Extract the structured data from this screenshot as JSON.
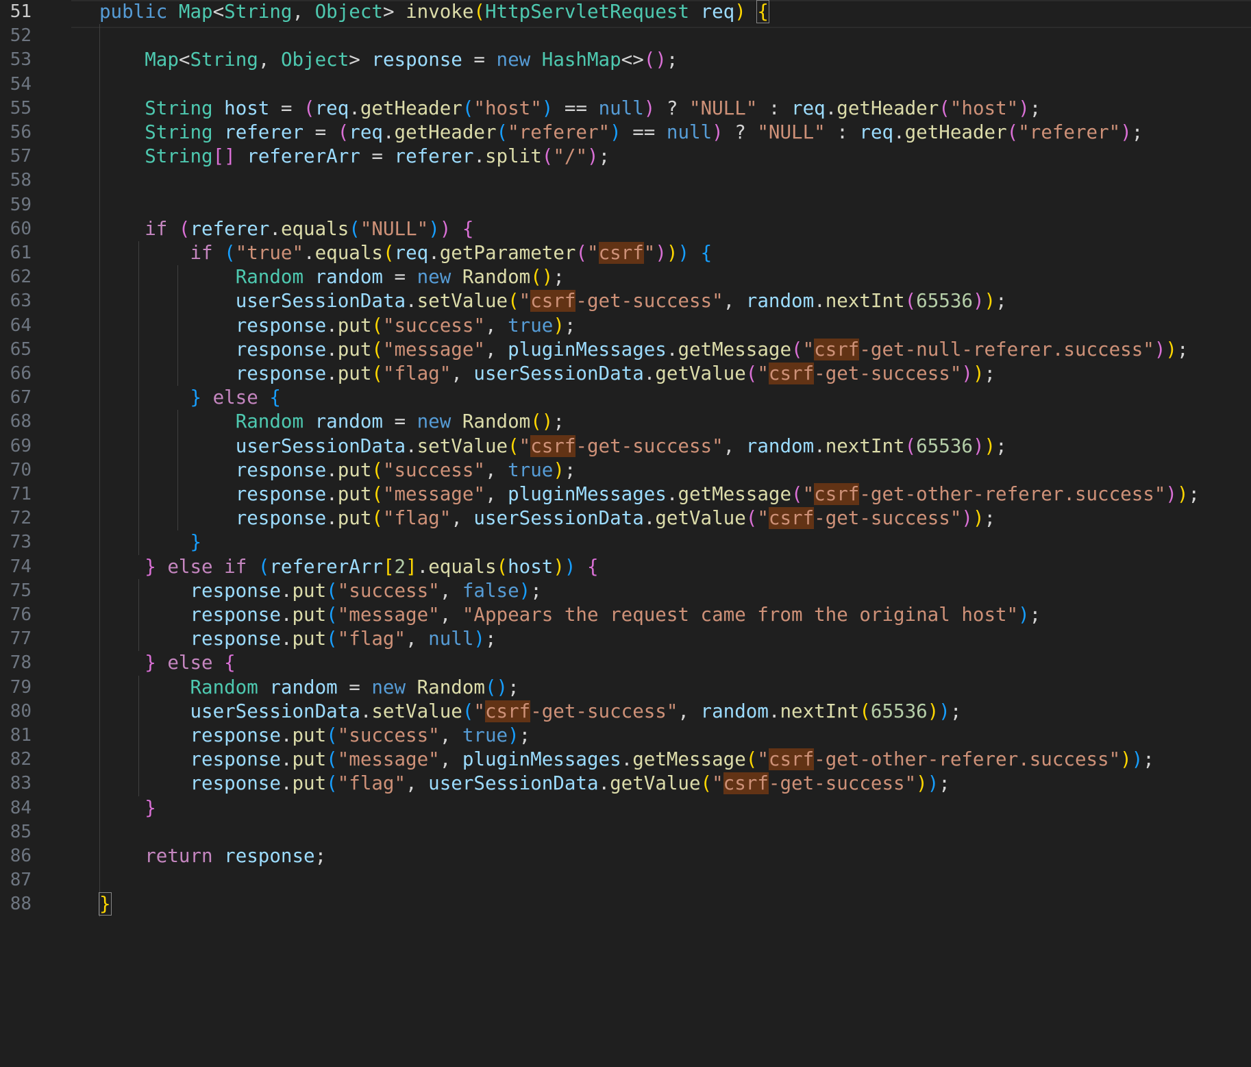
{
  "editor": {
    "language": "java",
    "theme_colors": {
      "background": "#1f1f1f",
      "keyword": "#569cd6",
      "control": "#c586c0",
      "type": "#4ec9b0",
      "function": "#dcdcaa",
      "variable": "#9cdcfe",
      "string": "#ce9178",
      "number": "#b5cea8",
      "search_highlight": "#623315",
      "line_number": "#6e7681",
      "line_number_active": "#cccccc"
    },
    "search_term": "csrf",
    "active_line": 51,
    "line_numbers": [
      "51",
      "52",
      "53",
      "54",
      "55",
      "56",
      "57",
      "58",
      "59",
      "60",
      "61",
      "62",
      "63",
      "64",
      "65",
      "66",
      "67",
      "68",
      "69",
      "70",
      "71",
      "72",
      "73",
      "74",
      "75",
      "76",
      "77",
      "78",
      "79",
      "80",
      "81",
      "82",
      "83",
      "84",
      "85",
      "86",
      "87",
      "88"
    ]
  },
  "code": [
    [
      [
        "k",
        "public "
      ],
      [
        "t",
        "Map"
      ],
      [
        "p",
        "<"
      ],
      [
        "t",
        "String"
      ],
      [
        "p",
        ", "
      ],
      [
        "t",
        "Object"
      ],
      [
        "p",
        "> "
      ],
      [
        "f",
        "invoke"
      ],
      [
        "b1",
        "("
      ],
      [
        "t",
        "HttpServletRequest"
      ],
      [
        "p",
        " "
      ],
      [
        "v",
        "req"
      ],
      [
        "b1",
        ")"
      ],
      [
        "p",
        " "
      ],
      [
        "b1c",
        "{"
      ]
    ],
    [],
    [
      [
        "p",
        "    "
      ],
      [
        "t",
        "Map"
      ],
      [
        "p",
        "<"
      ],
      [
        "t",
        "String"
      ],
      [
        "p",
        ", "
      ],
      [
        "t",
        "Object"
      ],
      [
        "p",
        "> "
      ],
      [
        "v",
        "response"
      ],
      [
        "p",
        " = "
      ],
      [
        "k",
        "new "
      ],
      [
        "t",
        "HashMap"
      ],
      [
        "p",
        "<>"
      ],
      [
        "b2",
        "()"
      ],
      [
        "p",
        ";"
      ]
    ],
    [],
    [
      [
        "p",
        "    "
      ],
      [
        "t",
        "String"
      ],
      [
        "p",
        " "
      ],
      [
        "v",
        "host"
      ],
      [
        "p",
        " = "
      ],
      [
        "b2",
        "("
      ],
      [
        "v",
        "req"
      ],
      [
        "p",
        "."
      ],
      [
        "f",
        "getHeader"
      ],
      [
        "b3",
        "("
      ],
      [
        "s",
        "\"host\""
      ],
      [
        "b3",
        ")"
      ],
      [
        "p",
        " == "
      ],
      [
        "k",
        "null"
      ],
      [
        "b2",
        ")"
      ],
      [
        "p",
        " ? "
      ],
      [
        "s",
        "\"NULL\""
      ],
      [
        "p",
        " : "
      ],
      [
        "v",
        "req"
      ],
      [
        "p",
        "."
      ],
      [
        "f",
        "getHeader"
      ],
      [
        "b2",
        "("
      ],
      [
        "s",
        "\"host\""
      ],
      [
        "b2",
        ")"
      ],
      [
        "p",
        ";"
      ]
    ],
    [
      [
        "p",
        "    "
      ],
      [
        "t",
        "String"
      ],
      [
        "p",
        " "
      ],
      [
        "v",
        "referer"
      ],
      [
        "p",
        " = "
      ],
      [
        "b2",
        "("
      ],
      [
        "v",
        "req"
      ],
      [
        "p",
        "."
      ],
      [
        "f",
        "getHeader"
      ],
      [
        "b3",
        "("
      ],
      [
        "s",
        "\"referer\""
      ],
      [
        "b3",
        ")"
      ],
      [
        "p",
        " == "
      ],
      [
        "k",
        "null"
      ],
      [
        "b2",
        ")"
      ],
      [
        "p",
        " ? "
      ],
      [
        "s",
        "\"NULL\""
      ],
      [
        "p",
        " : "
      ],
      [
        "v",
        "req"
      ],
      [
        "p",
        "."
      ],
      [
        "f",
        "getHeader"
      ],
      [
        "b2",
        "("
      ],
      [
        "s",
        "\"referer\""
      ],
      [
        "b2",
        ")"
      ],
      [
        "p",
        ";"
      ]
    ],
    [
      [
        "p",
        "    "
      ],
      [
        "t",
        "String"
      ],
      [
        "b2",
        "[]"
      ],
      [
        "p",
        " "
      ],
      [
        "v",
        "refererArr"
      ],
      [
        "p",
        " = "
      ],
      [
        "v",
        "referer"
      ],
      [
        "p",
        "."
      ],
      [
        "f",
        "split"
      ],
      [
        "b2",
        "("
      ],
      [
        "s",
        "\"/\""
      ],
      [
        "b2",
        ")"
      ],
      [
        "p",
        ";"
      ]
    ],
    [],
    [],
    [
      [
        "p",
        "    "
      ],
      [
        "kc",
        "if "
      ],
      [
        "b2",
        "("
      ],
      [
        "v",
        "referer"
      ],
      [
        "p",
        "."
      ],
      [
        "f",
        "equals"
      ],
      [
        "b3",
        "("
      ],
      [
        "s",
        "\"NULL\""
      ],
      [
        "b3",
        ")"
      ],
      [
        "b2",
        ")"
      ],
      [
        "p",
        " "
      ],
      [
        "b2",
        "{"
      ]
    ],
    [
      [
        "p",
        "        "
      ],
      [
        "kc",
        "if "
      ],
      [
        "b3",
        "("
      ],
      [
        "s",
        "\""
      ],
      [
        "s",
        "true"
      ],
      [
        "s",
        "\""
      ],
      [
        "p",
        "."
      ],
      [
        "f",
        "equals"
      ],
      [
        "b1",
        "("
      ],
      [
        "v",
        "req"
      ],
      [
        "p",
        "."
      ],
      [
        "f",
        "getParameter"
      ],
      [
        "b2",
        "("
      ],
      [
        "s",
        "\""
      ],
      [
        "sh",
        "csrf"
      ],
      [
        "s",
        "\""
      ],
      [
        "b2",
        ")"
      ],
      [
        "b1",
        ")"
      ],
      [
        "b3",
        ")"
      ],
      [
        "p",
        " "
      ],
      [
        "b3",
        "{"
      ]
    ],
    [
      [
        "p",
        "            "
      ],
      [
        "t",
        "Random"
      ],
      [
        "p",
        " "
      ],
      [
        "v",
        "random"
      ],
      [
        "p",
        " = "
      ],
      [
        "k",
        "new "
      ],
      [
        "f",
        "Random"
      ],
      [
        "b1",
        "()"
      ],
      [
        "p",
        ";"
      ]
    ],
    [
      [
        "p",
        "            "
      ],
      [
        "v",
        "userSessionData"
      ],
      [
        "p",
        "."
      ],
      [
        "f",
        "setValue"
      ],
      [
        "b1",
        "("
      ],
      [
        "s",
        "\""
      ],
      [
        "sh",
        "csrf"
      ],
      [
        "s",
        "-get-success\""
      ],
      [
        "p",
        ", "
      ],
      [
        "v",
        "random"
      ],
      [
        "p",
        "."
      ],
      [
        "f",
        "nextInt"
      ],
      [
        "b2",
        "("
      ],
      [
        "n",
        "65536"
      ],
      [
        "b2",
        ")"
      ],
      [
        "b1",
        ")"
      ],
      [
        "p",
        ";"
      ]
    ],
    [
      [
        "p",
        "            "
      ],
      [
        "v",
        "response"
      ],
      [
        "p",
        "."
      ],
      [
        "f",
        "put"
      ],
      [
        "b1",
        "("
      ],
      [
        "s",
        "\"success\""
      ],
      [
        "p",
        ", "
      ],
      [
        "k",
        "true"
      ],
      [
        "b1",
        ")"
      ],
      [
        "p",
        ";"
      ]
    ],
    [
      [
        "p",
        "            "
      ],
      [
        "v",
        "response"
      ],
      [
        "p",
        "."
      ],
      [
        "f",
        "put"
      ],
      [
        "b1",
        "("
      ],
      [
        "s",
        "\"message\""
      ],
      [
        "p",
        ", "
      ],
      [
        "v",
        "pluginMessages"
      ],
      [
        "p",
        "."
      ],
      [
        "f",
        "getMessage"
      ],
      [
        "b2",
        "("
      ],
      [
        "s",
        "\""
      ],
      [
        "sh",
        "csrf"
      ],
      [
        "s",
        "-get-null-referer.success\""
      ],
      [
        "b2",
        ")"
      ],
      [
        "b1",
        ")"
      ],
      [
        "p",
        ";"
      ]
    ],
    [
      [
        "p",
        "            "
      ],
      [
        "v",
        "response"
      ],
      [
        "p",
        "."
      ],
      [
        "f",
        "put"
      ],
      [
        "b1",
        "("
      ],
      [
        "s",
        "\"flag\""
      ],
      [
        "p",
        ", "
      ],
      [
        "v",
        "userSessionData"
      ],
      [
        "p",
        "."
      ],
      [
        "f",
        "getValue"
      ],
      [
        "b2",
        "("
      ],
      [
        "s",
        "\""
      ],
      [
        "sh",
        "csrf"
      ],
      [
        "s",
        "-get-success\""
      ],
      [
        "b2",
        ")"
      ],
      [
        "b1",
        ")"
      ],
      [
        "p",
        ";"
      ]
    ],
    [
      [
        "p",
        "        "
      ],
      [
        "b3",
        "}"
      ],
      [
        "kc",
        " else "
      ],
      [
        "b3",
        "{"
      ]
    ],
    [
      [
        "p",
        "            "
      ],
      [
        "t",
        "Random"
      ],
      [
        "p",
        " "
      ],
      [
        "v",
        "random"
      ],
      [
        "p",
        " = "
      ],
      [
        "k",
        "new "
      ],
      [
        "f",
        "Random"
      ],
      [
        "b1",
        "()"
      ],
      [
        "p",
        ";"
      ]
    ],
    [
      [
        "p",
        "            "
      ],
      [
        "v",
        "userSessionData"
      ],
      [
        "p",
        "."
      ],
      [
        "f",
        "setValue"
      ],
      [
        "b1",
        "("
      ],
      [
        "s",
        "\""
      ],
      [
        "sh",
        "csrf"
      ],
      [
        "s",
        "-get-success\""
      ],
      [
        "p",
        ", "
      ],
      [
        "v",
        "random"
      ],
      [
        "p",
        "."
      ],
      [
        "f",
        "nextInt"
      ],
      [
        "b2",
        "("
      ],
      [
        "n",
        "65536"
      ],
      [
        "b2",
        ")"
      ],
      [
        "b1",
        ")"
      ],
      [
        "p",
        ";"
      ]
    ],
    [
      [
        "p",
        "            "
      ],
      [
        "v",
        "response"
      ],
      [
        "p",
        "."
      ],
      [
        "f",
        "put"
      ],
      [
        "b1",
        "("
      ],
      [
        "s",
        "\"success\""
      ],
      [
        "p",
        ", "
      ],
      [
        "k",
        "true"
      ],
      [
        "b1",
        ")"
      ],
      [
        "p",
        ";"
      ]
    ],
    [
      [
        "p",
        "            "
      ],
      [
        "v",
        "response"
      ],
      [
        "p",
        "."
      ],
      [
        "f",
        "put"
      ],
      [
        "b1",
        "("
      ],
      [
        "s",
        "\"message\""
      ],
      [
        "p",
        ", "
      ],
      [
        "v",
        "pluginMessages"
      ],
      [
        "p",
        "."
      ],
      [
        "f",
        "getMessage"
      ],
      [
        "b2",
        "("
      ],
      [
        "s",
        "\""
      ],
      [
        "sh",
        "csrf"
      ],
      [
        "s",
        "-get-other-referer.success\""
      ],
      [
        "b2",
        ")"
      ],
      [
        "b1",
        ")"
      ],
      [
        "p",
        ";"
      ]
    ],
    [
      [
        "p",
        "            "
      ],
      [
        "v",
        "response"
      ],
      [
        "p",
        "."
      ],
      [
        "f",
        "put"
      ],
      [
        "b1",
        "("
      ],
      [
        "s",
        "\"flag\""
      ],
      [
        "p",
        ", "
      ],
      [
        "v",
        "userSessionData"
      ],
      [
        "p",
        "."
      ],
      [
        "f",
        "getValue"
      ],
      [
        "b2",
        "("
      ],
      [
        "s",
        "\""
      ],
      [
        "sh",
        "csrf"
      ],
      [
        "s",
        "-get-success\""
      ],
      [
        "b2",
        ")"
      ],
      [
        "b1",
        ")"
      ],
      [
        "p",
        ";"
      ]
    ],
    [
      [
        "p",
        "        "
      ],
      [
        "b3",
        "}"
      ]
    ],
    [
      [
        "p",
        "    "
      ],
      [
        "b2",
        "}"
      ],
      [
        "kc",
        " else if "
      ],
      [
        "b3",
        "("
      ],
      [
        "v",
        "refererArr"
      ],
      [
        "b1",
        "["
      ],
      [
        "n",
        "2"
      ],
      [
        "b1",
        "]"
      ],
      [
        "p",
        "."
      ],
      [
        "f",
        "equals"
      ],
      [
        "b1",
        "("
      ],
      [
        "v",
        "host"
      ],
      [
        "b1",
        ")"
      ],
      [
        "b3",
        ")"
      ],
      [
        "p",
        " "
      ],
      [
        "b2",
        "{"
      ]
    ],
    [
      [
        "p",
        "        "
      ],
      [
        "v",
        "response"
      ],
      [
        "p",
        "."
      ],
      [
        "f",
        "put"
      ],
      [
        "b3",
        "("
      ],
      [
        "s",
        "\"success\""
      ],
      [
        "p",
        ", "
      ],
      [
        "k",
        "false"
      ],
      [
        "b3",
        ")"
      ],
      [
        "p",
        ";"
      ]
    ],
    [
      [
        "p",
        "        "
      ],
      [
        "v",
        "response"
      ],
      [
        "p",
        "."
      ],
      [
        "f",
        "put"
      ],
      [
        "b3",
        "("
      ],
      [
        "s",
        "\"message\""
      ],
      [
        "p",
        ", "
      ],
      [
        "s",
        "\"Appears the request came from the original host\""
      ],
      [
        "b3",
        ")"
      ],
      [
        "p",
        ";"
      ]
    ],
    [
      [
        "p",
        "        "
      ],
      [
        "v",
        "response"
      ],
      [
        "p",
        "."
      ],
      [
        "f",
        "put"
      ],
      [
        "b3",
        "("
      ],
      [
        "s",
        "\"flag\""
      ],
      [
        "p",
        ", "
      ],
      [
        "k",
        "null"
      ],
      [
        "b3",
        ")"
      ],
      [
        "p",
        ";"
      ]
    ],
    [
      [
        "p",
        "    "
      ],
      [
        "b2",
        "}"
      ],
      [
        "kc",
        " else "
      ],
      [
        "b2",
        "{"
      ]
    ],
    [
      [
        "p",
        "        "
      ],
      [
        "t",
        "Random"
      ],
      [
        "p",
        " "
      ],
      [
        "v",
        "random"
      ],
      [
        "p",
        " = "
      ],
      [
        "k",
        "new "
      ],
      [
        "f",
        "Random"
      ],
      [
        "b3",
        "()"
      ],
      [
        "p",
        ";"
      ]
    ],
    [
      [
        "p",
        "        "
      ],
      [
        "v",
        "userSessionData"
      ],
      [
        "p",
        "."
      ],
      [
        "f",
        "setValue"
      ],
      [
        "b3",
        "("
      ],
      [
        "s",
        "\""
      ],
      [
        "sh",
        "csrf"
      ],
      [
        "s",
        "-get-success\""
      ],
      [
        "p",
        ", "
      ],
      [
        "v",
        "random"
      ],
      [
        "p",
        "."
      ],
      [
        "f",
        "nextInt"
      ],
      [
        "b1",
        "("
      ],
      [
        "n",
        "65536"
      ],
      [
        "b1",
        ")"
      ],
      [
        "b3",
        ")"
      ],
      [
        "p",
        ";"
      ]
    ],
    [
      [
        "p",
        "        "
      ],
      [
        "v",
        "response"
      ],
      [
        "p",
        "."
      ],
      [
        "f",
        "put"
      ],
      [
        "b3",
        "("
      ],
      [
        "s",
        "\"success\""
      ],
      [
        "p",
        ", "
      ],
      [
        "k",
        "true"
      ],
      [
        "b3",
        ")"
      ],
      [
        "p",
        ";"
      ]
    ],
    [
      [
        "p",
        "        "
      ],
      [
        "v",
        "response"
      ],
      [
        "p",
        "."
      ],
      [
        "f",
        "put"
      ],
      [
        "b3",
        "("
      ],
      [
        "s",
        "\"message\""
      ],
      [
        "p",
        ", "
      ],
      [
        "v",
        "pluginMessages"
      ],
      [
        "p",
        "."
      ],
      [
        "f",
        "getMessage"
      ],
      [
        "b1",
        "("
      ],
      [
        "s",
        "\""
      ],
      [
        "sh",
        "csrf"
      ],
      [
        "s",
        "-get-other-referer.success\""
      ],
      [
        "b1",
        ")"
      ],
      [
        "b3",
        ")"
      ],
      [
        "p",
        ";"
      ]
    ],
    [
      [
        "p",
        "        "
      ],
      [
        "v",
        "response"
      ],
      [
        "p",
        "."
      ],
      [
        "f",
        "put"
      ],
      [
        "b3",
        "("
      ],
      [
        "s",
        "\"flag\""
      ],
      [
        "p",
        ", "
      ],
      [
        "v",
        "userSessionData"
      ],
      [
        "p",
        "."
      ],
      [
        "f",
        "getValue"
      ],
      [
        "b1",
        "("
      ],
      [
        "s",
        "\""
      ],
      [
        "sh",
        "csrf"
      ],
      [
        "s",
        "-get-success\""
      ],
      [
        "b1",
        ")"
      ],
      [
        "b3",
        ")"
      ],
      [
        "p",
        ";"
      ]
    ],
    [
      [
        "p",
        "    "
      ],
      [
        "b2",
        "}"
      ]
    ],
    [],
    [
      [
        "p",
        "    "
      ],
      [
        "kc",
        "return "
      ],
      [
        "v",
        "response"
      ],
      [
        "p",
        ";"
      ]
    ],
    [],
    [
      [
        "b1c",
        "}"
      ]
    ]
  ]
}
